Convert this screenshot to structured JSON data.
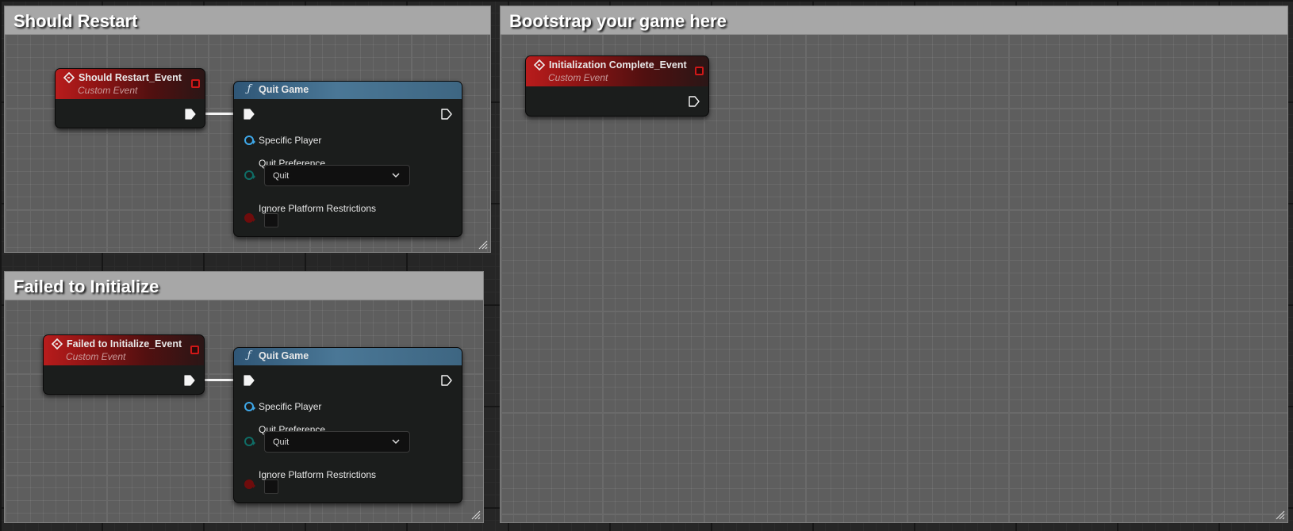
{
  "comments": {
    "should_restart": {
      "title": "Should Restart"
    },
    "failed_to_initialize": {
      "title": "Failed to Initialize"
    },
    "bootstrap": {
      "title": "Bootstrap your game here"
    }
  },
  "nodes": {
    "should_restart_event": {
      "title": "Should Restart_Event",
      "subtitle": "Custom Event"
    },
    "failed_to_initialize_event": {
      "title": "Failed to Initialize_Event",
      "subtitle": "Custom Event"
    },
    "initialization_complete_event": {
      "title": "Initialization Complete_Event",
      "subtitle": "Custom Event"
    },
    "quit_game_1": {
      "title": "Quit Game",
      "pins": {
        "specific_player": "Specific Player",
        "quit_preference": "Quit Preference",
        "quit_preference_value": "Quit",
        "ignore_platform_restrictions": "Ignore Platform Restrictions",
        "ignore_platform_restrictions_checked": false
      }
    },
    "quit_game_2": {
      "title": "Quit Game",
      "pins": {
        "specific_player": "Specific Player",
        "quit_preference": "Quit Preference",
        "quit_preference_value": "Quit",
        "ignore_platform_restrictions": "Ignore Platform Restrictions",
        "ignore_platform_restrictions_checked": false
      }
    }
  },
  "icons": {
    "event_node": "event-diamond-icon",
    "function_node": "function-f-icon",
    "exec_pin": "exec-arrow-icon",
    "delegate_pin": "delegate-square-icon",
    "dropdown": "chevron-down-icon",
    "resize": "resize-grip-icon"
  },
  "colors": {
    "event_header": "#b81c1c",
    "function_header": "#4a7796",
    "object_pin": "#3ea7e8",
    "enum_pin": "#0f6d66",
    "bool_pin": "#6e0c0c",
    "comment_header": "#a7a7a7",
    "exec_wire": "#f4f4f4"
  }
}
